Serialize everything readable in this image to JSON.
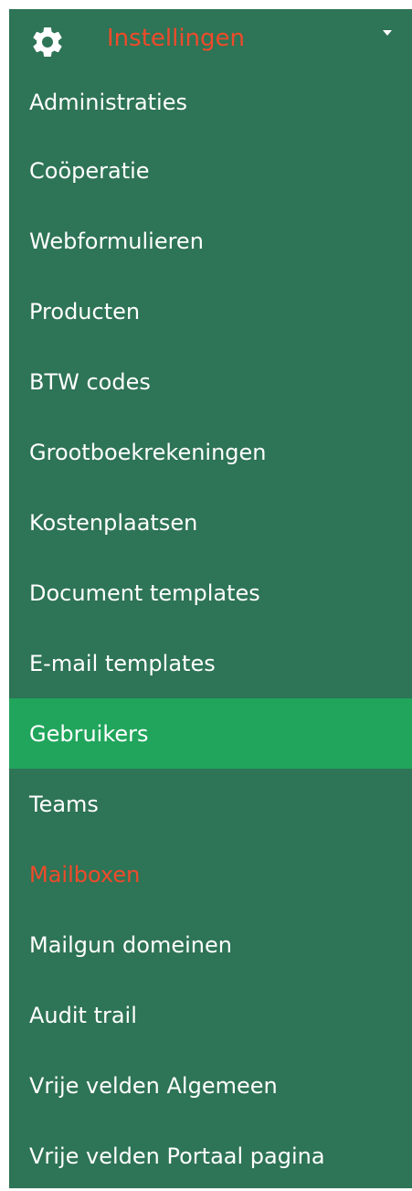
{
  "colors": {
    "sidebar_bg": "#2e7456",
    "active_bg": "#21a55c",
    "accent_text": "#ee4b2b",
    "text": "#ffffff"
  },
  "header": {
    "icon": "gear-icon",
    "title": "Instellingen",
    "caret_icon": "caret-down-icon"
  },
  "menu": {
    "items": [
      {
        "label": "Administraties",
        "name": "administraties"
      },
      {
        "label": "Coöperatie",
        "name": "cooperatie"
      },
      {
        "label": "Webformulieren",
        "name": "webformulieren"
      },
      {
        "label": "Producten",
        "name": "producten"
      },
      {
        "label": "BTW codes",
        "name": "btw-codes"
      },
      {
        "label": "Grootboekrekeningen",
        "name": "grootboekrekeningen"
      },
      {
        "label": "Kostenplaatsen",
        "name": "kostenplaatsen"
      },
      {
        "label": "Document templates",
        "name": "document-templates"
      },
      {
        "label": "E-mail templates",
        "name": "e-mail-templates"
      },
      {
        "label": "Gebruikers",
        "name": "gebruikers",
        "state": "active"
      },
      {
        "label": "Teams",
        "name": "teams"
      },
      {
        "label": "Mailboxen",
        "name": "mailboxen",
        "state": "highlighted"
      },
      {
        "label": "Mailgun domeinen",
        "name": "mailgun-domeinen"
      },
      {
        "label": "Audit trail",
        "name": "audit-trail"
      },
      {
        "label": "Vrije velden Algemeen",
        "name": "vrije-velden-algemeen"
      },
      {
        "label": "Vrije velden Portaal pagina",
        "name": "vrije-velden-portaal-pagina"
      }
    ]
  }
}
